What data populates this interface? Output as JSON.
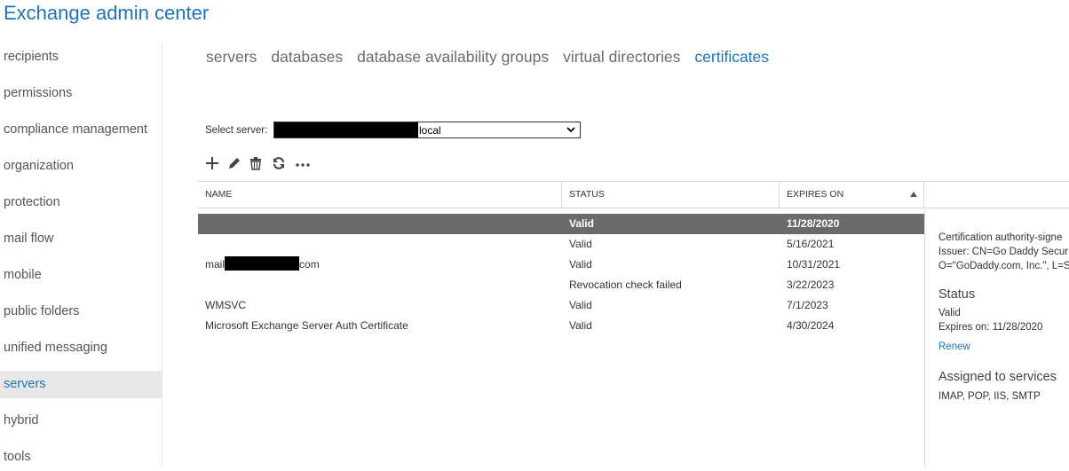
{
  "app": {
    "title": "Exchange admin center"
  },
  "sidebar": {
    "items": [
      {
        "label": "recipients",
        "active": false
      },
      {
        "label": "permissions",
        "active": false
      },
      {
        "label": "compliance management",
        "active": false
      },
      {
        "label": "organization",
        "active": false
      },
      {
        "label": "protection",
        "active": false
      },
      {
        "label": "mail flow",
        "active": false
      },
      {
        "label": "mobile",
        "active": false
      },
      {
        "label": "public folders",
        "active": false
      },
      {
        "label": "unified messaging",
        "active": false
      },
      {
        "label": "servers",
        "active": true
      },
      {
        "label": "hybrid",
        "active": false
      },
      {
        "label": "tools",
        "active": false
      }
    ]
  },
  "tabs": [
    {
      "label": "servers",
      "active": false
    },
    {
      "label": "databases",
      "active": false
    },
    {
      "label": "database availability groups",
      "active": false
    },
    {
      "label": "virtual directories",
      "active": false
    },
    {
      "label": "certificates",
      "active": true
    }
  ],
  "server_select": {
    "label": "Select server:",
    "value": "local"
  },
  "toolbar": {
    "icons": [
      "add-icon",
      "edit-icon",
      "delete-icon",
      "refresh-icon",
      "more-icon"
    ]
  },
  "table": {
    "columns": {
      "name": "NAME",
      "status": "STATUS",
      "expires": "EXPIRES ON"
    },
    "sort": {
      "column": "expires",
      "direction": "ascending"
    },
    "rows": [
      {
        "name": "",
        "status": "Valid",
        "expires": "11/28/2020",
        "selected": true
      },
      {
        "name": "",
        "status": "Valid",
        "expires": "5/16/2021",
        "selected": false
      },
      {
        "name_prefix": "mail",
        "name_suffix": "com",
        "status": "Valid",
        "expires": "10/31/2021",
        "selected": false
      },
      {
        "name": "",
        "status": "Revocation check failed",
        "expires": "3/22/2023",
        "selected": false
      },
      {
        "name": "WMSVC",
        "status": "Valid",
        "expires": "7/1/2023",
        "selected": false
      },
      {
        "name": "Microsoft Exchange Server Auth Certificate",
        "status": "Valid",
        "expires": "4/30/2024",
        "selected": false
      }
    ]
  },
  "details": {
    "type_line": "Certification authority-signe",
    "issuer_line1": "Issuer: CN=Go Daddy Secur",
    "issuer_line2": "O=\"GoDaddy.com, Inc.\", L=S",
    "status_heading": "Status",
    "status_value": "Valid",
    "expires_line": "Expires on: 11/28/2020",
    "renew_link": "Renew",
    "services_heading": "Assigned to services",
    "services_value": "IMAP, POP, IIS, SMTP"
  },
  "colors": {
    "accent": "#1e73be",
    "selected_row": "#6b6b6b",
    "nav_active_bg": "#e8e8e8"
  }
}
